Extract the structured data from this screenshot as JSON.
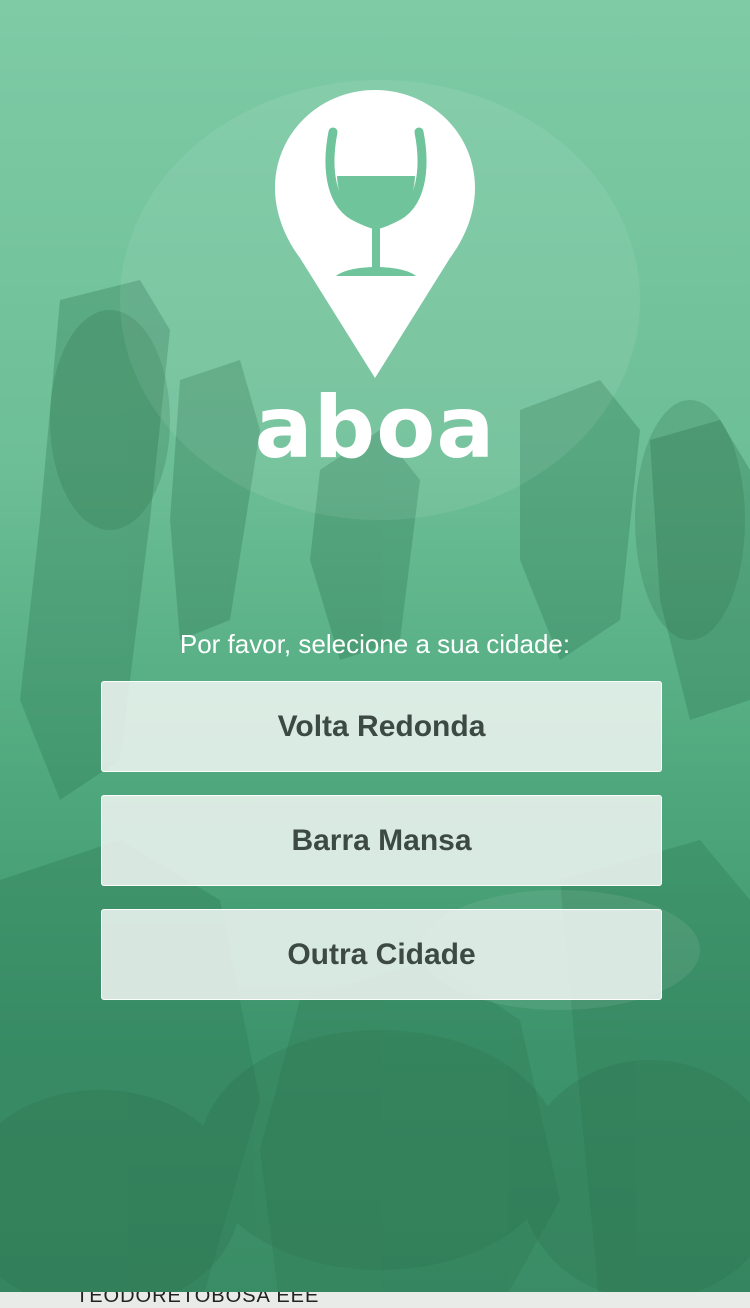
{
  "app": {
    "brand_name": "aboa",
    "accent_color": "#6fc49c",
    "logo_icon": "wine-glass-map-pin"
  },
  "city_selection": {
    "prompt": "Por favor, selecione a sua cidade:",
    "options": [
      {
        "label": "Volta Redonda"
      },
      {
        "label": "Barra Mansa"
      },
      {
        "label": "Outra Cidade"
      }
    ]
  },
  "background": {
    "image": "crowd-hands-raised",
    "overlay_color": "#5dbb8e"
  },
  "bottom_strip": {
    "text": "TEODORETOBOSA EEE"
  }
}
